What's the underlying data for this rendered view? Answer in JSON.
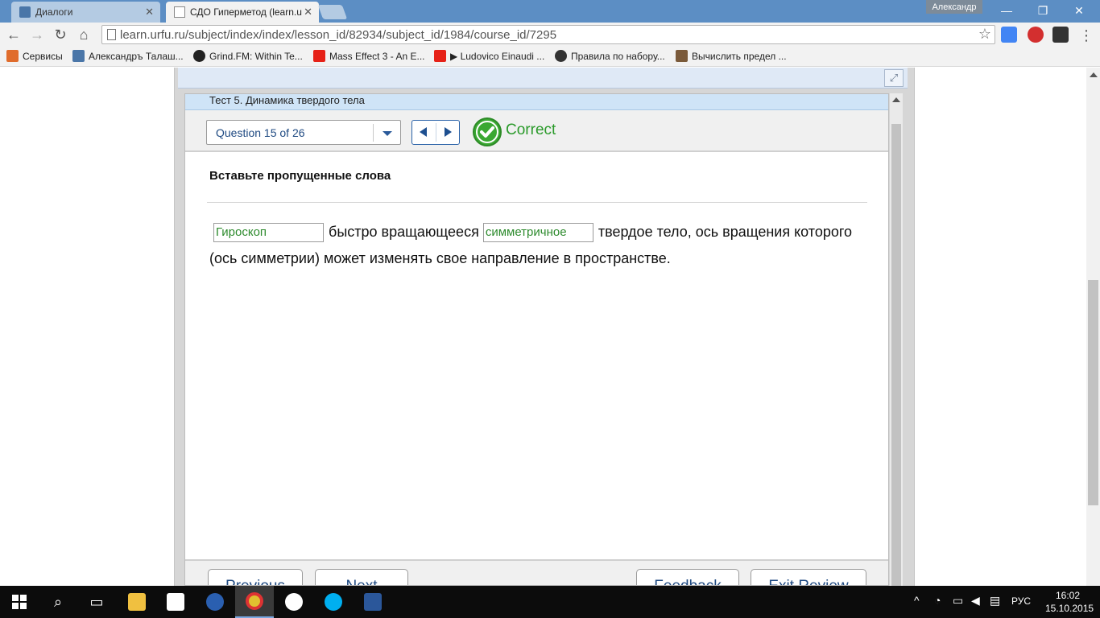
{
  "browser": {
    "tabs": [
      {
        "title": "Диалоги",
        "active": false
      },
      {
        "title": "СДО Гиперметод (learn.u",
        "active": true
      }
    ],
    "user_badge": "Александр",
    "url": "learn.urfu.ru/subject/index/index/lesson_id/82934/subject_id/1984/course_id/7295",
    "bookmarks": [
      {
        "label": "Сервисы",
        "icon": "apps-icon",
        "color": "#e06c2c"
      },
      {
        "label": "Александръ Талаш...",
        "icon": "vk-icon",
        "color": "#4a76a8"
      },
      {
        "label": "Grind.FM: Within Te...",
        "icon": "paw-icon",
        "color": "#222222"
      },
      {
        "label": "Mass Effect 3 - An E...",
        "icon": "youtube-icon",
        "color": "#e62117"
      },
      {
        "label": "▶ Ludovico Einaudi ...",
        "icon": "youtube-icon",
        "color": "#e62117"
      },
      {
        "label": "Правила по набору...",
        "icon": "globe-icon",
        "color": "#333333"
      },
      {
        "label": "Вычислить предел ...",
        "icon": "person-icon",
        "color": "#7a5a3a"
      }
    ]
  },
  "quiz": {
    "title": "Тест 5. Динамика твердого тела",
    "question_selector": "Question 15 of 26",
    "status": "Correct",
    "prompt": "Вставьте пропущенные слова",
    "answer1": "Гироскоп",
    "text1": "быстро вращающееся",
    "answer2": "симметричное",
    "text2": "твердое тело, ось вращения которого (ось симметрии) может изменять свое направление в пространстве.",
    "buttons": {
      "previous": "Previous",
      "next": "Next",
      "feedback": "Feedback",
      "exit_review": "Exit Review"
    }
  },
  "taskbar": {
    "language": "РУС",
    "time": "16:02",
    "date": "15.10.2015"
  },
  "colors": {
    "correct_green": "#2a9a2a",
    "title_blue": "#5c8ec4",
    "link_blue": "#1f4a82"
  }
}
